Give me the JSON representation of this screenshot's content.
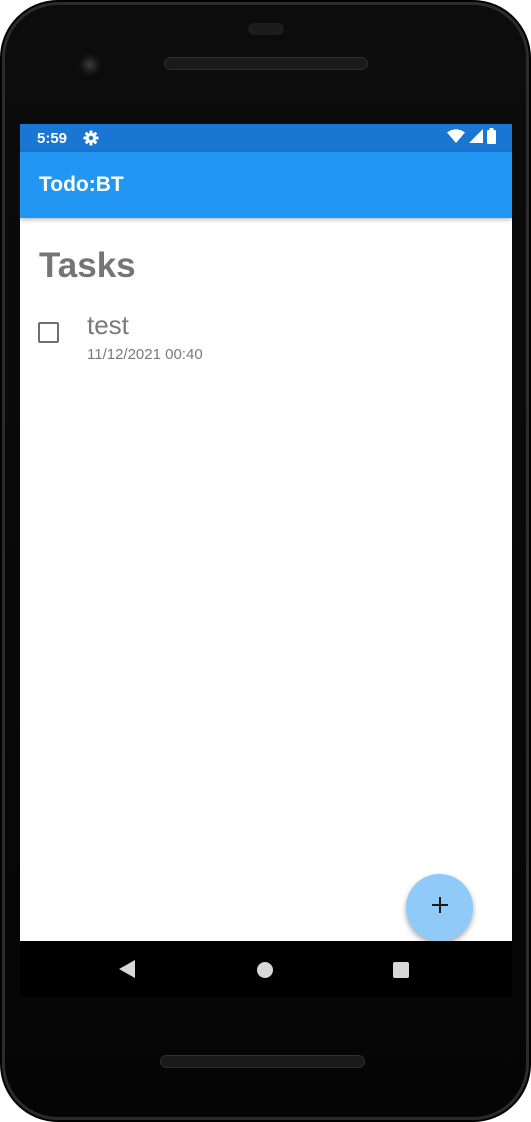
{
  "status_bar": {
    "time": "5:59",
    "icons": [
      "gear-icon",
      "wifi-icon",
      "cellular-signal-icon",
      "battery-icon"
    ],
    "color": "#1976d2"
  },
  "app_bar": {
    "title": "Todo:BT",
    "color": "#2196f3"
  },
  "main": {
    "heading": "Tasks",
    "tasks": [
      {
        "title": "test",
        "date": "11/12/2021 00:40",
        "checked": false
      }
    ]
  },
  "fab": {
    "icon": "plus-icon",
    "color": "#90caf9"
  },
  "nav_bar": {
    "icons": [
      "back-icon",
      "home-icon",
      "recents-icon"
    ]
  }
}
